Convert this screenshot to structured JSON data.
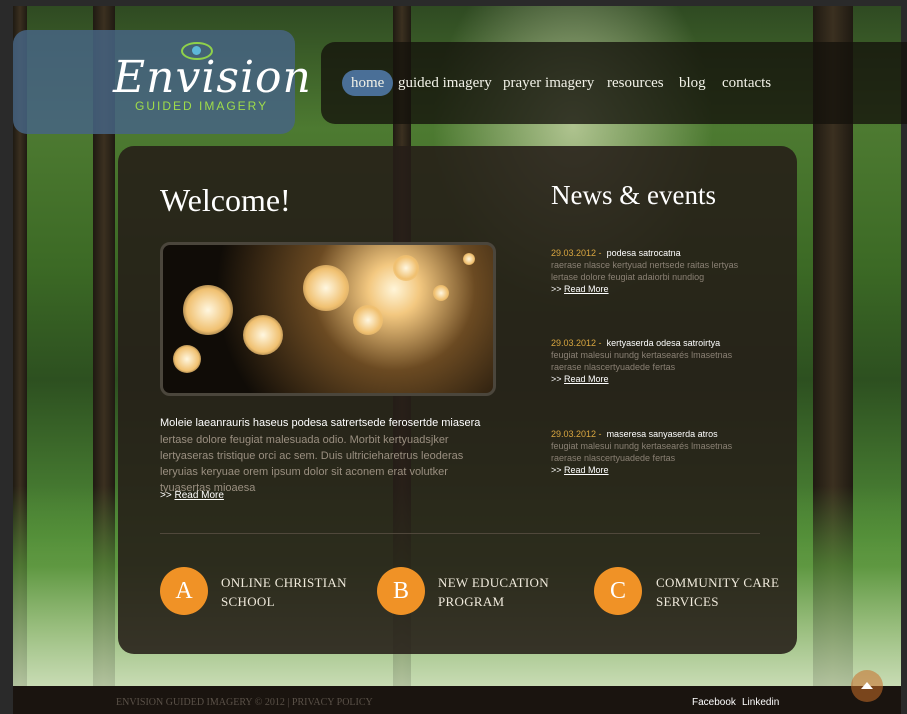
{
  "logo": {
    "name": "Envision",
    "tagline": "GUIDED IMAGERY"
  },
  "nav": {
    "items": [
      {
        "label": "home",
        "active": true
      },
      {
        "label": "guided imagery",
        "active": false
      },
      {
        "label": "prayer imagery",
        "active": false
      },
      {
        "label": "resources",
        "active": false
      },
      {
        "label": "blog",
        "active": false
      },
      {
        "label": "contacts",
        "active": false
      }
    ]
  },
  "welcome": {
    "title": "Welcome!",
    "lead": "Moleie laeanrauris haseus podesa satrertsede ferosertde miasera",
    "body": "lertase dolore feugiat malesuada odio. Morbit kertyuadsjker lertyaseras tristique orci ac sem. Duis ultricieharetrus leoderas leryuias keryuae orem ipsum dolor sit aconem erat volutker tyuasertas mioaesa",
    "arrow": ">>",
    "read_more": "Read More"
  },
  "news": {
    "title": "News & events",
    "items": [
      {
        "date": "29.03.2012 -",
        "headline": "podesa satrocatna",
        "body": "raerase nlasce kertyuad nertsede raitas lertyas lertase dolore feugiat adaiorbi nundiog",
        "arrow": ">>",
        "read_more": "Read More"
      },
      {
        "date": "29.03.2012 -",
        "headline": "kertyaserda odesa satroirtya",
        "body": "feugiat malesui nundg kertasearés lmasetnas raerase nlascertyuadede fertas",
        "arrow": ">>",
        "read_more": "Read More"
      },
      {
        "date": "29.03.2012 -",
        "headline": "maseresa sanyaserda atros",
        "body": "feugiat malesui nundg kertasearés lmasetnas raerase nlascertyuadede fertas",
        "arrow": ">>",
        "read_more": "Read More"
      }
    ]
  },
  "features": [
    {
      "letter": "A",
      "line1": "ONLINE CHRISTIAN",
      "line2": "SCHOOL"
    },
    {
      "letter": "B",
      "line1": "NEW EDUCATION",
      "line2": "PROGRAM"
    },
    {
      "letter": "C",
      "line1": "COMMUNITY CARE",
      "line2": "SERVICES"
    }
  ],
  "footer": {
    "copyright": "ENVISION GUIDED IMAGERY © 2012",
    "separator": "|",
    "privacy": "PRIVACY POLICY",
    "social": [
      "Facebook",
      "Linkedin"
    ]
  },
  "colors": {
    "accent": "#f09226",
    "nav_active": "#4a6f97",
    "date": "#d9a640"
  }
}
